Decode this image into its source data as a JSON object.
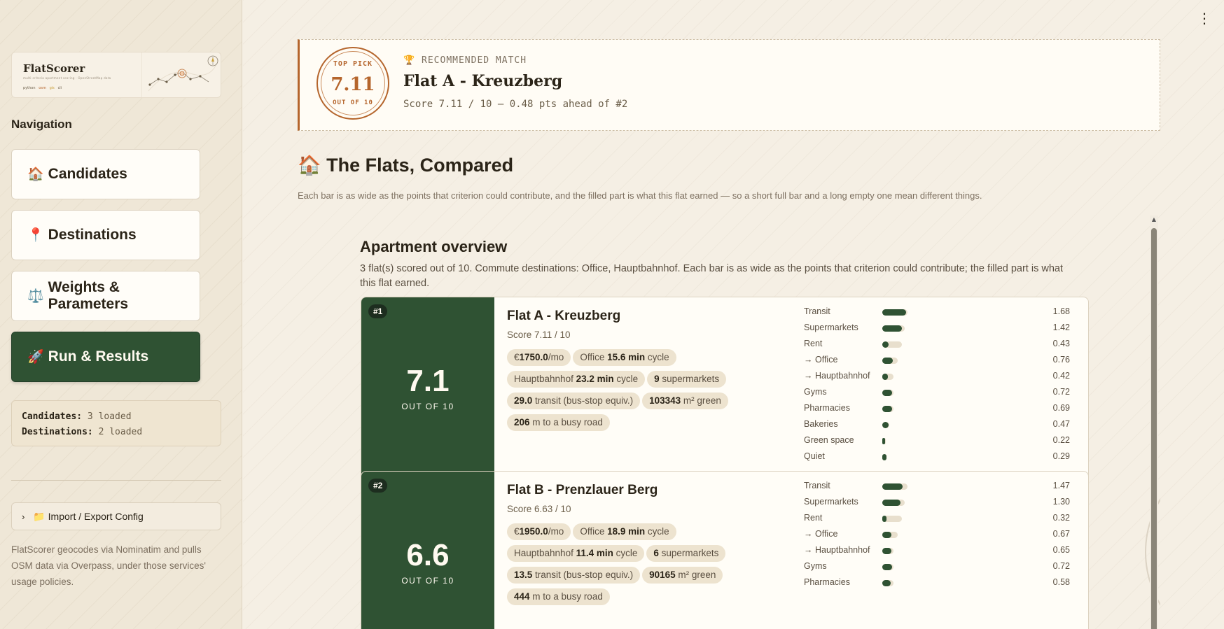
{
  "app": {
    "logo_title": "FlatScorer",
    "logo_subtitle": "multi-criteria apartment scoring · OpenStreetMap data",
    "logo_tags": [
      "python",
      "osm",
      "gis",
      "cli"
    ]
  },
  "sidebar": {
    "nav_title": "Navigation",
    "items": [
      {
        "icon": "🏠",
        "icon_name": "house-icon",
        "label": "Candidates",
        "active": false
      },
      {
        "icon": "📍",
        "icon_name": "pin-icon",
        "label": "Destinations",
        "active": false
      },
      {
        "icon": "⚖️",
        "icon_name": "scales-icon",
        "label": "Weights & Parameters",
        "active": false
      },
      {
        "icon": "🚀",
        "icon_name": "rocket-icon",
        "label": "Run & Results",
        "active": true
      }
    ],
    "status": {
      "candidates_label": "Candidates:",
      "candidates_value": "3 loaded",
      "destinations_label": "Destinations:",
      "destinations_value": "2 loaded"
    },
    "expander_label": "📁 Import / Export Config",
    "footer": "FlatScorer geocodes via Nominatim and pulls OSM data via Overpass, under those services' usage policies."
  },
  "top_pick": {
    "seal_top": "TOP PICK",
    "seal_score": "7.11",
    "seal_bottom": "OUT OF 10",
    "label": "🏆 RECOMMENDED MATCH",
    "name": "Flat A - Kreuzberg",
    "score_line": "Score 7.11 / 10 — 0.48 pts ahead of #2"
  },
  "section": {
    "title": "🏠 The Flats, Compared",
    "description": "Each bar is as wide as the points that criterion could contribute, and the filled part is what this flat earned — so a short full bar and a long empty one mean different things."
  },
  "overview": {
    "title": "Apartment overview",
    "description": "3 flat(s) scored out of 10. Commute destinations: Office, Hauptbahnhof. Each bar is as wide as the points that criterion could contribute; the filled part is what this flat earned."
  },
  "cards": [
    {
      "rank": "#1",
      "big_score": "7.1",
      "out_of": "OUT OF 10",
      "name": "Flat A - Kreuzberg",
      "score": "Score 7.11 / 10",
      "chips": [
        {
          "pre": "€",
          "bold": "1750.0",
          "post": "/mo"
        },
        {
          "pre": "Office ",
          "bold": "15.6 min",
          "post": " cycle"
        },
        {
          "pre": "Hauptbahnhof ",
          "bold": "23.2 min",
          "post": " cycle"
        },
        {
          "pre": "",
          "bold": "9",
          "post": " supermarkets"
        },
        {
          "pre": "",
          "bold": "29.0",
          "post": " transit (bus-stop equiv.)"
        },
        {
          "pre": "",
          "bold": "103343",
          "post": " m² green"
        },
        {
          "pre": "",
          "bold": "206",
          "post": " m to a busy road"
        }
      ],
      "criteria": [
        {
          "label": "Transit",
          "value": "1.68",
          "max": 1.8,
          "earned": 1.68
        },
        {
          "label": "Supermarkets",
          "value": "1.42",
          "max": 1.6,
          "earned": 1.42
        },
        {
          "label": "Rent",
          "value": "0.43",
          "max": 1.4,
          "earned": 0.43
        },
        {
          "label": "→ Office",
          "value": "0.76",
          "max": 1.1,
          "earned": 0.76
        },
        {
          "label": "→ Hauptbahnhof",
          "value": "0.42",
          "max": 0.8,
          "earned": 0.42
        },
        {
          "label": "Gyms",
          "value": "0.72",
          "max": 0.8,
          "earned": 0.72
        },
        {
          "label": "Pharmacies",
          "value": "0.69",
          "max": 0.8,
          "earned": 0.69
        },
        {
          "label": "Bakeries",
          "value": "0.47",
          "max": 0.5,
          "earned": 0.47
        },
        {
          "label": "Green space",
          "value": "0.22",
          "max": 0.25,
          "earned": 0.22
        },
        {
          "label": "Quiet",
          "value": "0.29",
          "max": 0.3,
          "earned": 0.29
        }
      ]
    },
    {
      "rank": "#2",
      "big_score": "6.6",
      "out_of": "OUT OF 10",
      "name": "Flat B - Prenzlauer Berg",
      "score": "Score 6.63 / 10",
      "chips": [
        {
          "pre": "€",
          "bold": "1950.0",
          "post": "/mo"
        },
        {
          "pre": "Office ",
          "bold": "18.9 min",
          "post": " cycle"
        },
        {
          "pre": "Hauptbahnhof ",
          "bold": "11.4 min",
          "post": " cycle"
        },
        {
          "pre": "",
          "bold": "6",
          "post": " supermarkets"
        },
        {
          "pre": "",
          "bold": "13.5",
          "post": " transit (bus-stop equiv.)"
        },
        {
          "pre": "",
          "bold": "90165",
          "post": " m² green"
        },
        {
          "pre": "",
          "bold": "444",
          "post": " m to a busy road"
        }
      ],
      "criteria": [
        {
          "label": "Transit",
          "value": "1.47",
          "max": 1.8,
          "earned": 1.47
        },
        {
          "label": "Supermarkets",
          "value": "1.30",
          "max": 1.6,
          "earned": 1.3
        },
        {
          "label": "Rent",
          "value": "0.32",
          "max": 1.4,
          "earned": 0.32
        },
        {
          "label": "→ Office",
          "value": "0.67",
          "max": 1.1,
          "earned": 0.67
        },
        {
          "label": "→ Hauptbahnhof",
          "value": "0.65",
          "max": 0.8,
          "earned": 0.65
        },
        {
          "label": "Gyms",
          "value": "0.72",
          "max": 0.8,
          "earned": 0.72
        },
        {
          "label": "Pharmacies",
          "value": "0.58",
          "max": 0.8,
          "earned": 0.58
        }
      ]
    }
  ],
  "colors": {
    "accent_green": "#2f5233",
    "seal_orange": "#b5652c",
    "background": "#f5efe4"
  }
}
